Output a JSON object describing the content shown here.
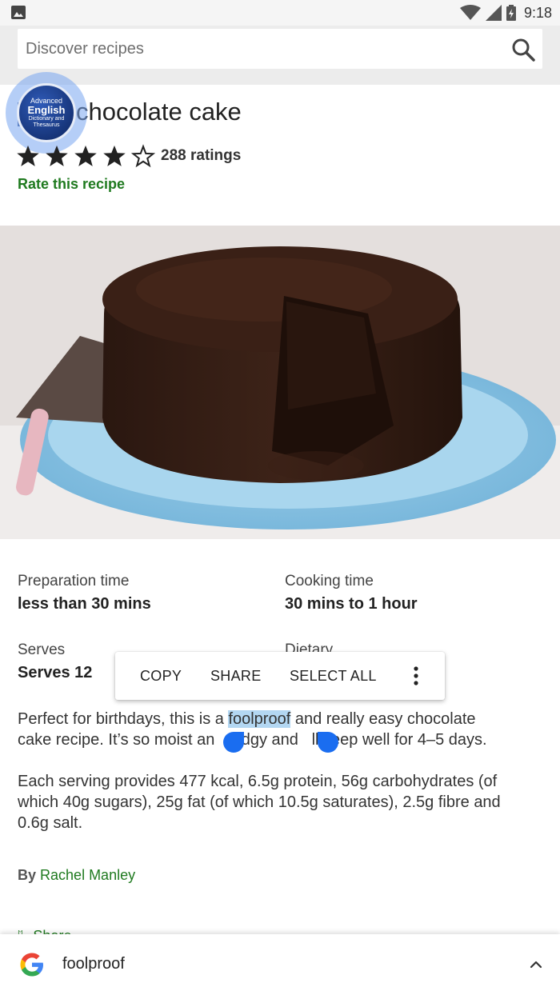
{
  "status_bar": {
    "time": "9:18"
  },
  "search": {
    "placeholder": "Discover recipes"
  },
  "recipe": {
    "title": "chocolate cake",
    "rating": 4,
    "rating_max": 5,
    "ratings_count": "288 ratings",
    "rate_link": "Rate this recipe"
  },
  "floating_app": {
    "line1": "Advanced",
    "line2": "English",
    "line3": "Dictionary and",
    "line4": "Thesaurus"
  },
  "details": {
    "prep_label": "Preparation time",
    "prep_value": "less than 30 mins",
    "cook_label": "Cooking time",
    "cook_value": "30 mins to 1 hour",
    "serves_label": "Serves",
    "serves_value": "Serves 12",
    "dietary_label": "Dietary"
  },
  "selection_toolbar": {
    "copy": "COPY",
    "share": "SHARE",
    "select_all": "SELECT ALL"
  },
  "description": {
    "line1_before": "Perfect for birthdays, this is a ",
    "selected_word": "foolproof",
    "line1_after": " and really easy chocolate",
    "line2_a": "cake recipe. It’s so moist an",
    "line2_b": "fudgy and",
    "line2_c": "ll keep well for 4–5 days."
  },
  "nutrition": {
    "line1": "Each serving provides 477 kcal, 6.5g protein, 56g carbohydrates (of",
    "line2": "which 40g sugars), 25g fat (of which 10.5g saturates), 2.5g fibre and",
    "line3": "0.6g salt."
  },
  "byline": {
    "prefix": "By",
    "author": "Rachel Manley"
  },
  "share_label": "Share",
  "bottom_sheet": {
    "query": "foolproof"
  },
  "colors": {
    "link_green": "#1f7a1f",
    "selection_blue": "#b3d7f2",
    "handle_blue": "#1a6df0"
  }
}
